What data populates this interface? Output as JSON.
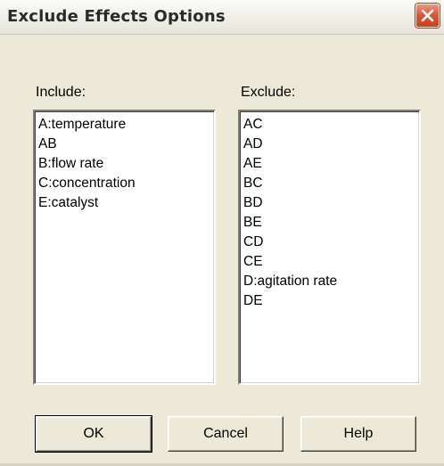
{
  "window": {
    "title": "Exclude Effects Options"
  },
  "include": {
    "label": "Include:",
    "items": [
      "A:temperature",
      "AB",
      "B:flow rate",
      "C:concentration",
      "E:catalyst"
    ]
  },
  "exclude": {
    "label": "Exclude:",
    "items": [
      "AC",
      "AD",
      "AE",
      "BC",
      "BD",
      "BE",
      "CD",
      "CE",
      "D:agitation rate",
      "DE"
    ]
  },
  "buttons": {
    "ok": "OK",
    "cancel": "Cancel",
    "help": "Help"
  },
  "colors": {
    "dialog_bg": "#ece9d8",
    "close_button": "#d9593b"
  }
}
